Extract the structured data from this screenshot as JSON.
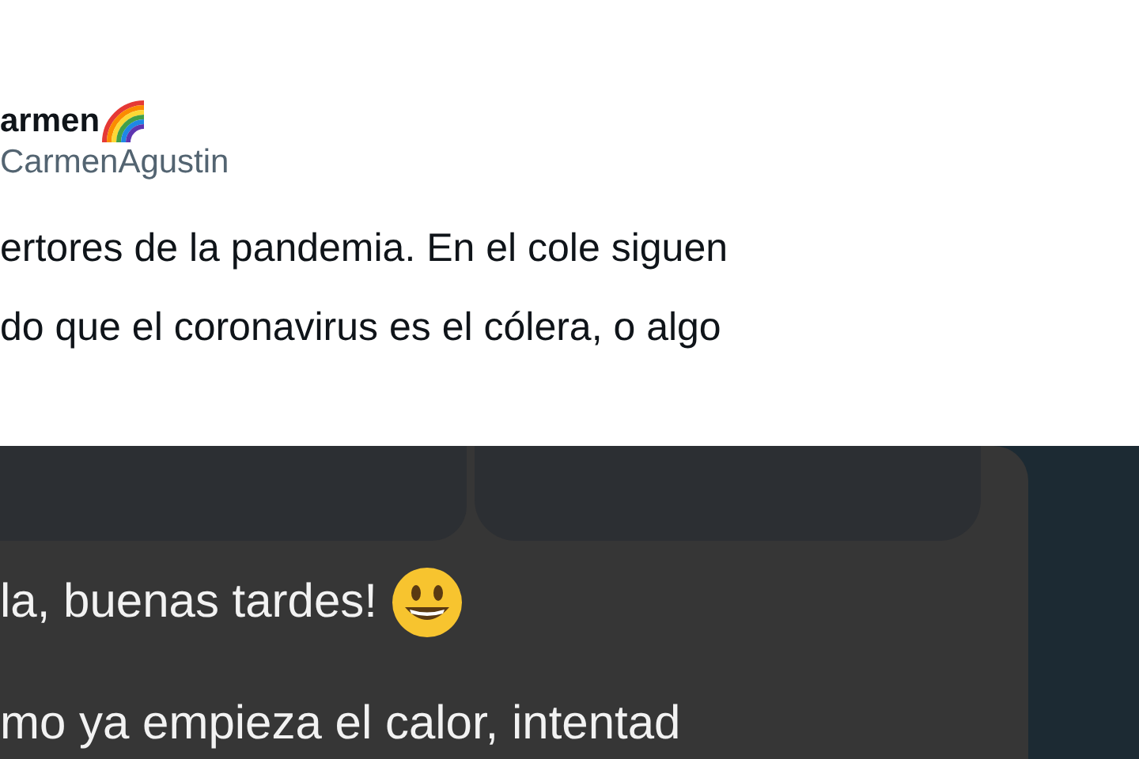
{
  "tweet": {
    "display_name": "armen",
    "handle": "CarmenAgustin",
    "text_lines": [
      "ertores de la pandemia. En el cole siguen",
      "do que el coronavirus es el cólera, o algo"
    ]
  },
  "chat_screenshot": {
    "message_lines": [
      "la, buenas tardes!",
      "mo ya empieza el calor, intentad"
    ]
  }
}
